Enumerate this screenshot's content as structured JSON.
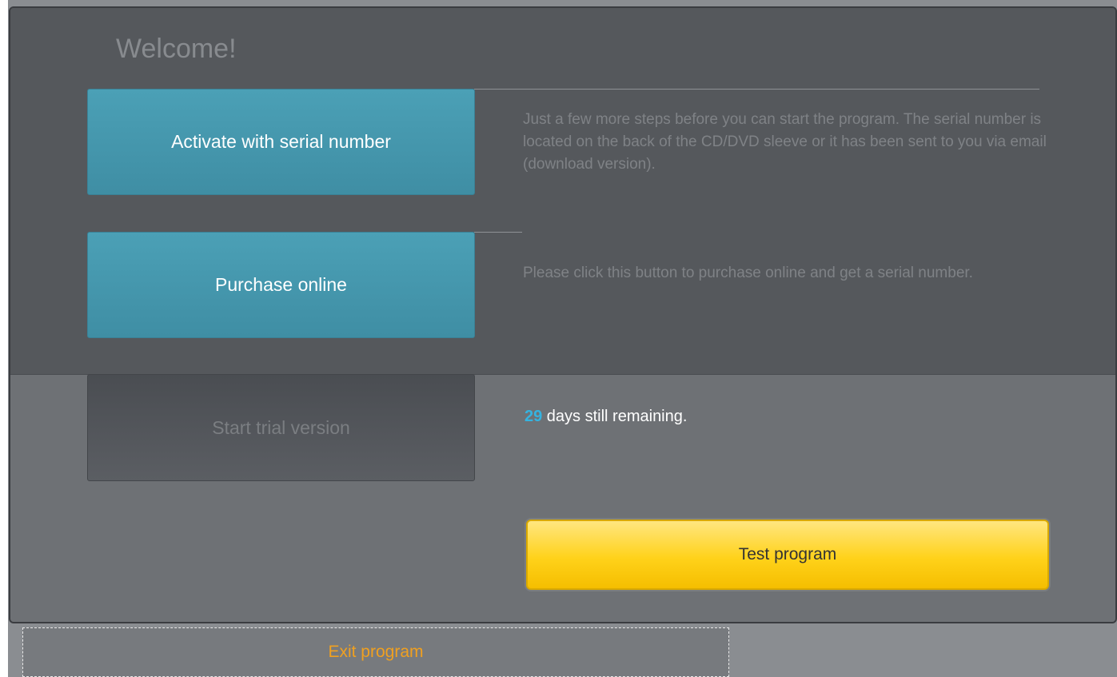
{
  "dialog": {
    "title": "Welcome!"
  },
  "activate": {
    "button_label": "Activate with serial number",
    "description": "Just a few more steps before you can start the program. The serial number is located on the back of the CD/DVD sleeve or it has been sent to you via email (download version)."
  },
  "purchase": {
    "button_label": "Purchase online",
    "description": "Please click this button to purchase online and get a serial number."
  },
  "trial": {
    "button_label": "Start trial version",
    "days_remaining": "29",
    "days_text": " days still remaining."
  },
  "test": {
    "button_label": "Test program"
  },
  "exit": {
    "button_label": "Exit program"
  },
  "colors": {
    "accent_blue": "#4ba0b6",
    "highlight_days": "#35b3e0",
    "test_button_yellow": "#ffd21a",
    "exit_text_orange": "#f0a020"
  }
}
